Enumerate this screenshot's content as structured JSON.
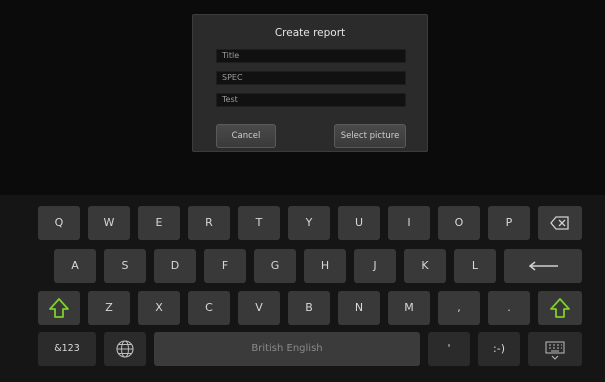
{
  "dialog": {
    "title": "Create report",
    "fields": [
      {
        "name": "title-field",
        "value": "Title"
      },
      {
        "name": "spec-field",
        "value": "SPEC"
      },
      {
        "name": "test-field",
        "value": "Test"
      }
    ],
    "cancel_label": "Cancel",
    "select_picture_label": "Select picture"
  },
  "keyboard": {
    "row1": [
      "Q",
      "W",
      "E",
      "R",
      "T",
      "Y",
      "U",
      "I",
      "O",
      "P"
    ],
    "row2": [
      "A",
      "S",
      "D",
      "F",
      "G",
      "H",
      "J",
      "K",
      "L"
    ],
    "row3": [
      "Z",
      "X",
      "C",
      "V",
      "B",
      "N",
      "M",
      ",",
      "."
    ],
    "symbols_label": "&123",
    "space_label": "British English",
    "apostrophe_label": "'",
    "smiley_label": ":-)",
    "icons": {
      "backspace": "backspace-icon",
      "enter": "enter-arrow-icon",
      "shift": "shift-arrow-icon",
      "language": "globe-icon",
      "hide": "keyboard-hide-icon"
    },
    "shift_color": "#7ecf2a"
  }
}
